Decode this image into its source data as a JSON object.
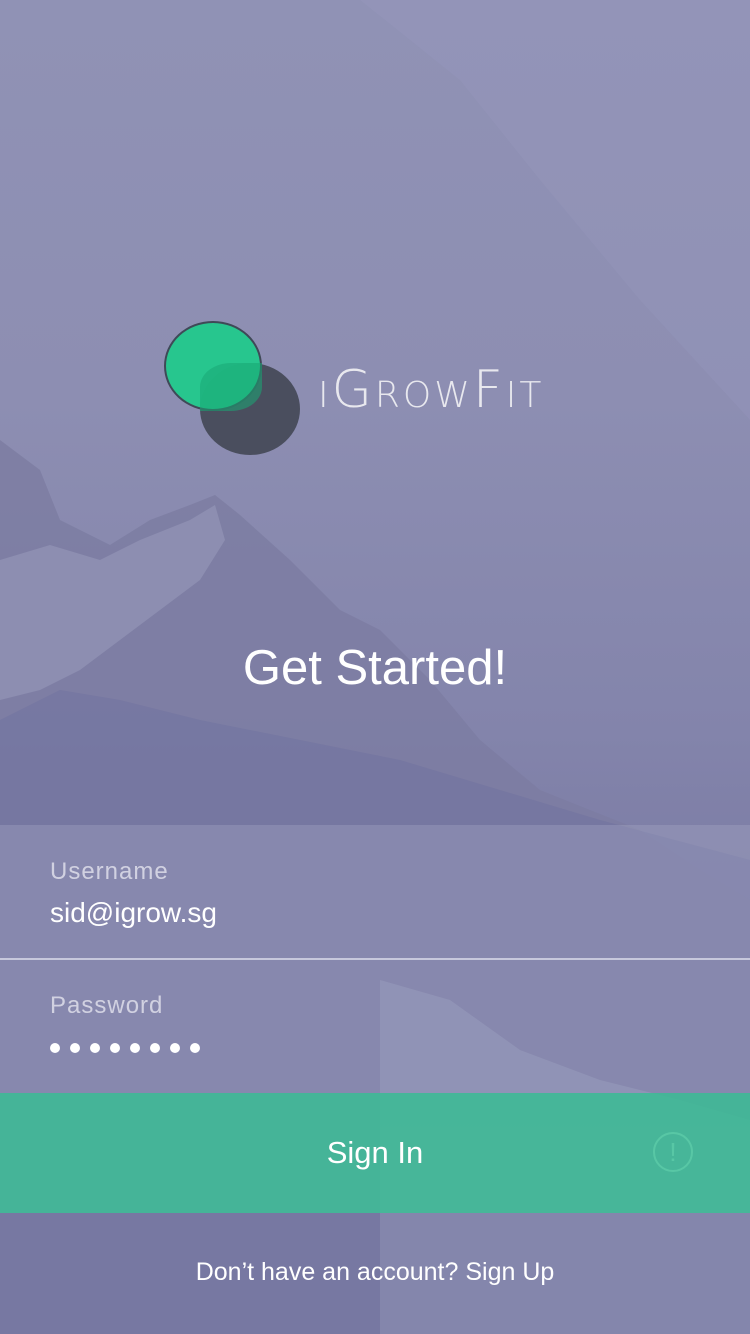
{
  "brand": {
    "logo_text": "iGrowFit",
    "green": "#23c98d",
    "dark": "#4a4e5e"
  },
  "headline": "Get Started!",
  "form": {
    "username_label": "Username",
    "username_value": "sid@igrow.sg",
    "password_label": "Password",
    "password_dot_count": 8,
    "alert_icon": "!"
  },
  "actions": {
    "signin_label": "Sign In",
    "signin_color": "#3cbe96"
  },
  "footer": {
    "prompt": "Don’t have an account?",
    "signup_label": "Sign Up"
  }
}
